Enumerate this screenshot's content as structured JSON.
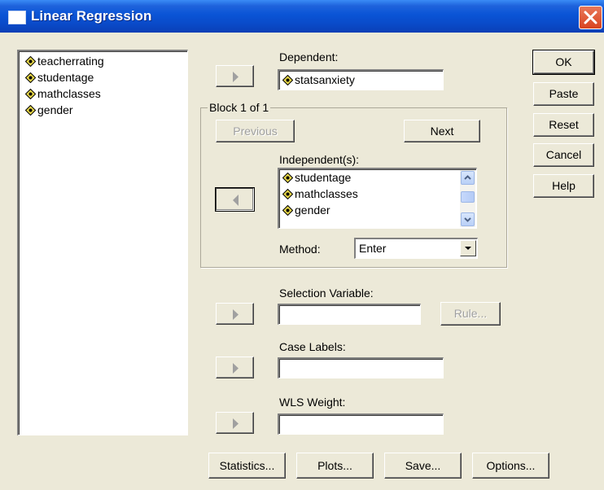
{
  "window": {
    "title": "Linear Regression"
  },
  "source_list": {
    "items": [
      "teacherrating",
      "studentage",
      "mathclasses",
      "gender"
    ]
  },
  "dependent": {
    "label": "Dependent:",
    "value": "statsanxiety"
  },
  "block": {
    "label": "Block 1 of 1",
    "previous_label": "Previous",
    "next_label": "Next",
    "independents_label": "Independent(s):",
    "independents": [
      "studentage",
      "mathclasses",
      "gender"
    ],
    "method_label": "Method:",
    "method_value": "Enter"
  },
  "selection_variable": {
    "label": "Selection Variable:",
    "value": "",
    "rule_label": "Rule..."
  },
  "case_labels": {
    "label": "Case Labels:",
    "value": ""
  },
  "wls_weight": {
    "label": "WLS Weight:",
    "value": ""
  },
  "side_buttons": {
    "ok": "OK",
    "paste": "Paste",
    "reset": "Reset",
    "cancel": "Cancel",
    "help": "Help"
  },
  "bottom_buttons": {
    "statistics": "Statistics...",
    "plots": "Plots...",
    "save": "Save...",
    "options": "Options..."
  },
  "icons": {
    "variable": "scale-variable-icon",
    "transfer": "right-arrow-icon",
    "remove": "left-arrow-icon",
    "close": "close-icon"
  },
  "colors": {
    "title_bar": "#0a54d6",
    "close_button": "#d9441f",
    "dialog_bg": "#ece9d8"
  }
}
